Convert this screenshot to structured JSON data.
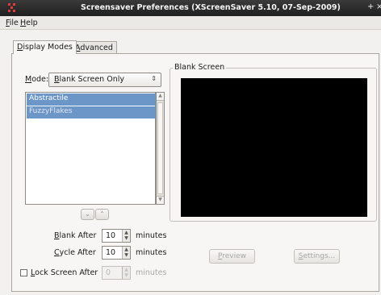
{
  "titlebar": {
    "title": "Screensaver Preferences  (XScreenSaver 5.10, 07-Sep-2009)",
    "plus": "+",
    "close": "×"
  },
  "menubar": {
    "file": {
      "mnemonic": "F",
      "rest": "ile"
    },
    "help": {
      "mnemonic": "H",
      "rest": "elp"
    }
  },
  "tabs": [
    {
      "mnemonic": "D",
      "rest": "isplay Modes",
      "active": true
    },
    {
      "mnemonic": "A",
      "rest": "dvanced",
      "active": false
    }
  ],
  "mode": {
    "label_mnemonic": "M",
    "label_rest": "ode:",
    "selected_mnemonic": "B",
    "selected_rest": "lank Screen Only"
  },
  "savers": {
    "items": [
      "Abstractile",
      "FuzzyFlakes"
    ],
    "selected_index": 1
  },
  "nav": {
    "down": "⌄",
    "up": "⌃"
  },
  "blank_after": {
    "label_mnemonic": "B",
    "label_rest": "lank After",
    "value": "10",
    "unit": "minutes"
  },
  "cycle_after": {
    "label_mnemonic": "C",
    "label_rest": "ycle After",
    "value": "10",
    "unit": "minutes"
  },
  "lock_screen": {
    "label_mnemonic": "L",
    "label_rest": "ock Screen After",
    "value": "0",
    "unit": "minutes",
    "checked": false
  },
  "preview_frame": {
    "title": "Blank Screen"
  },
  "buttons": {
    "preview": {
      "mnemonic": "P",
      "rest": "review"
    },
    "settings": {
      "mnemonic": "S",
      "rest": "ettings..."
    }
  },
  "colors": {
    "selection": "#6d96c8",
    "titlebar": "#2b2b2b",
    "screen": "#000000"
  }
}
